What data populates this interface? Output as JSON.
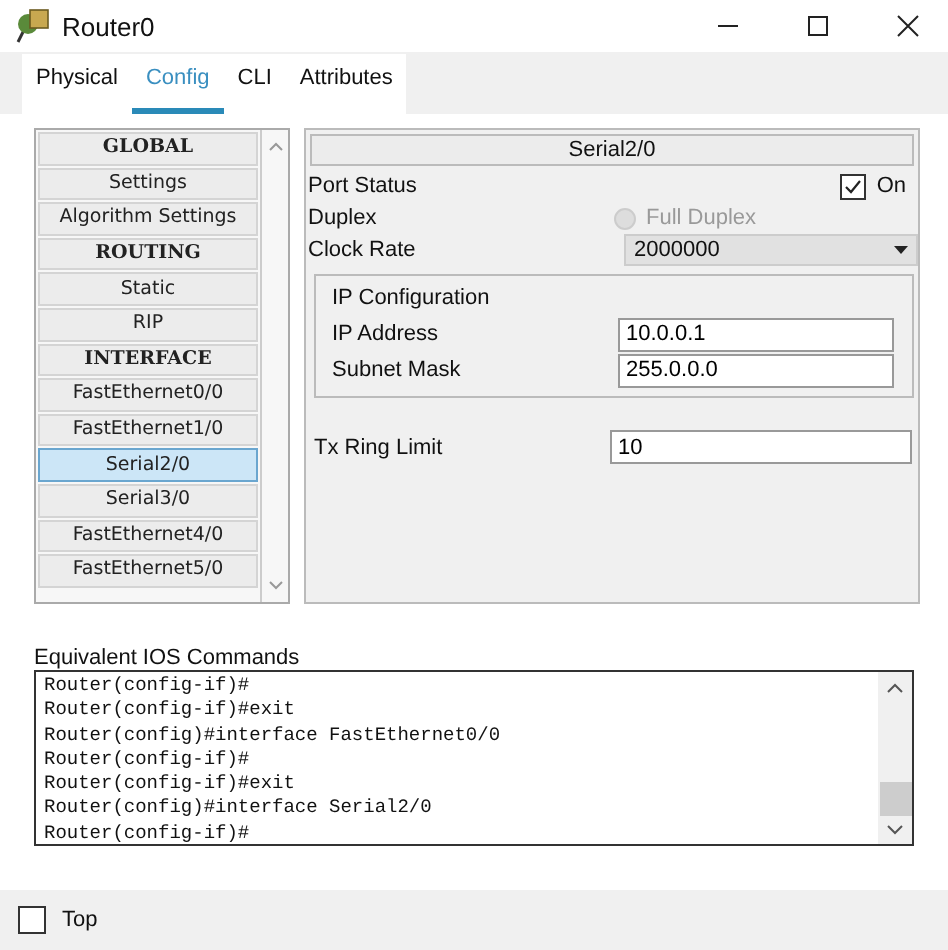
{
  "window": {
    "title": "Router0"
  },
  "tabs": [
    {
      "label": "Physical",
      "selected": false
    },
    {
      "label": "Config",
      "selected": true
    },
    {
      "label": "CLI",
      "selected": false
    },
    {
      "label": "Attributes",
      "selected": false
    }
  ],
  "sidebar": {
    "items": [
      {
        "kind": "header",
        "label": "GLOBAL",
        "selected": false
      },
      {
        "kind": "item",
        "label": "Settings",
        "selected": false
      },
      {
        "kind": "item",
        "label": "Algorithm Settings",
        "selected": false
      },
      {
        "kind": "header",
        "label": "ROUTING",
        "selected": false
      },
      {
        "kind": "item",
        "label": "Static",
        "selected": false
      },
      {
        "kind": "item",
        "label": "RIP",
        "selected": false
      },
      {
        "kind": "header",
        "label": "INTERFACE",
        "selected": false
      },
      {
        "kind": "item",
        "label": "FastEthernet0/0",
        "selected": false
      },
      {
        "kind": "item",
        "label": "FastEthernet1/0",
        "selected": false
      },
      {
        "kind": "item",
        "label": "Serial2/0",
        "selected": true
      },
      {
        "kind": "item",
        "label": "Serial3/0",
        "selected": false
      },
      {
        "kind": "item",
        "label": "FastEthernet4/0",
        "selected": false
      },
      {
        "kind": "item",
        "label": "FastEthernet5/0",
        "selected": false
      }
    ]
  },
  "panel": {
    "title": "Serial2/0",
    "port_status": {
      "label": "Port Status",
      "checked": true,
      "text": "On"
    },
    "duplex": {
      "label": "Duplex",
      "option": "Full Duplex",
      "disabled": true
    },
    "clock_rate": {
      "label": "Clock Rate",
      "value": "2000000"
    },
    "ip_configuration": {
      "title": "IP Configuration",
      "fields": [
        {
          "label": "IP Address",
          "value": "10.0.0.1"
        },
        {
          "label": "Subnet Mask",
          "value": "255.0.0.0"
        }
      ]
    },
    "tx_ring_limit": {
      "label": "Tx Ring Limit",
      "value": "10"
    }
  },
  "commands": {
    "label": "Equivalent IOS Commands",
    "lines": [
      "Router(config-if)#",
      "Router(config-if)#exit",
      "Router(config)#interface FastEthernet0/0",
      "Router(config-if)#",
      "Router(config-if)#exit",
      "Router(config)#interface Serial2/0",
      "Router(config-if)#"
    ]
  },
  "top_checkbox": {
    "label": "Top",
    "checked": false
  }
}
